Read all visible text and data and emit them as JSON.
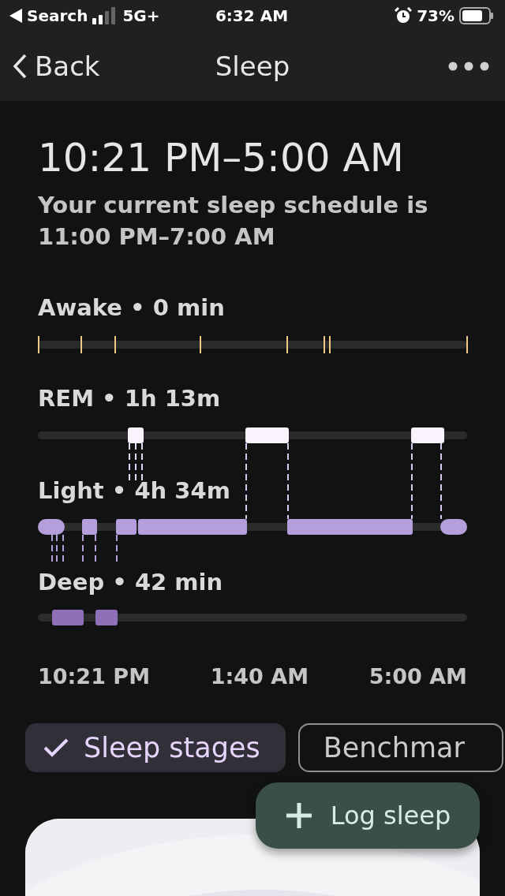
{
  "status_bar": {
    "back_label": "Search",
    "network": "5G+",
    "time": "6:32 AM",
    "battery": "73%"
  },
  "nav": {
    "back": "Back",
    "title": "Sleep"
  },
  "summary": {
    "time_range": "10:21 PM–5:00 AM",
    "schedule": "Your current sleep schedule is 11:00 PM–7:00 AM"
  },
  "stages": [
    {
      "label": "Awake • 0 min"
    },
    {
      "label": "REM • 1h 13m"
    },
    {
      "label": "Light • 4h 34m"
    },
    {
      "label": "Deep • 42 min"
    }
  ],
  "axis_labels": [
    "10:21 PM",
    "1:40 AM",
    "5:00 AM"
  ],
  "chips": [
    {
      "label": "Sleep stages",
      "selected": true
    },
    {
      "label": "Benchmar",
      "selected": false
    }
  ],
  "fab": {
    "label": "Log sleep"
  }
}
